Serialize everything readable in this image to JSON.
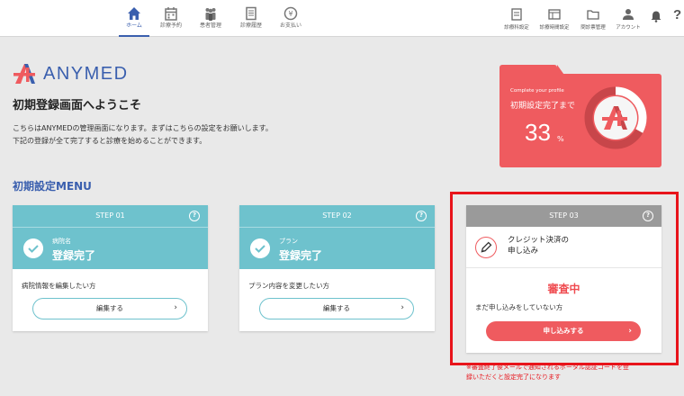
{
  "nav": {
    "items": [
      {
        "label": "ホーム",
        "icon": "home-icon"
      },
      {
        "label": "診療予約",
        "icon": "calendar-icon"
      },
      {
        "label": "患者管理",
        "icon": "patients-icon"
      },
      {
        "label": "診療履歴",
        "icon": "history-icon"
      },
      {
        "label": "お支払い",
        "icon": "payment-icon"
      }
    ],
    "right_items": [
      {
        "label": "診療科設定",
        "icon": "department-settings-icon"
      },
      {
        "label": "診療時間設定",
        "icon": "hours-settings-icon"
      },
      {
        "label": "問診票管理",
        "icon": "questionnaire-folder-icon"
      },
      {
        "label": "アカウント",
        "icon": "account-icon"
      }
    ],
    "bell_icon": "bell-icon",
    "help_label": "?"
  },
  "header": {
    "logo_text": "ANYMED",
    "welcome": "初期登録画面へようこそ",
    "intro_line1": "こちらはANYMEDの管理画面になります。まずはこちらの設定をお願いします。",
    "intro_line2": "下記の登録が全て完了すると診療を始めることができます。"
  },
  "progress": {
    "subtitle": "Complete your profile",
    "title": "初期設定完了まで",
    "value": "33",
    "unit": "%",
    "fraction": 0.33
  },
  "section_title": "初期設定MENU",
  "steps": [
    {
      "header": "STEP 01",
      "help": "?",
      "small": "病院名",
      "status": "登録完了",
      "desc": "病院情報を編集したい方",
      "button": "編集する",
      "arrow": "›"
    },
    {
      "header": "STEP 02",
      "help": "?",
      "small": "プラン",
      "status": "登録完了",
      "desc": "プラン内容を変更したい方",
      "button": "編集する",
      "arrow": "›"
    },
    {
      "header": "STEP 03",
      "help": "?",
      "title_line1": "クレジット決済の",
      "title_line2": "申し込み",
      "status": "審査中",
      "desc": "まだ申し込みをしていない方",
      "button": "申し込みする",
      "arrow": "›"
    }
  ],
  "note_line1": "※審査終了後メールで通知されるポータル認証コードを登",
  "note_line2": "録いただくと設定完了になります",
  "colors": {
    "accent": "#3a5fae",
    "teal": "#6ec2cd",
    "red": "#ef5b5f",
    "highlight": "#e8141b"
  }
}
